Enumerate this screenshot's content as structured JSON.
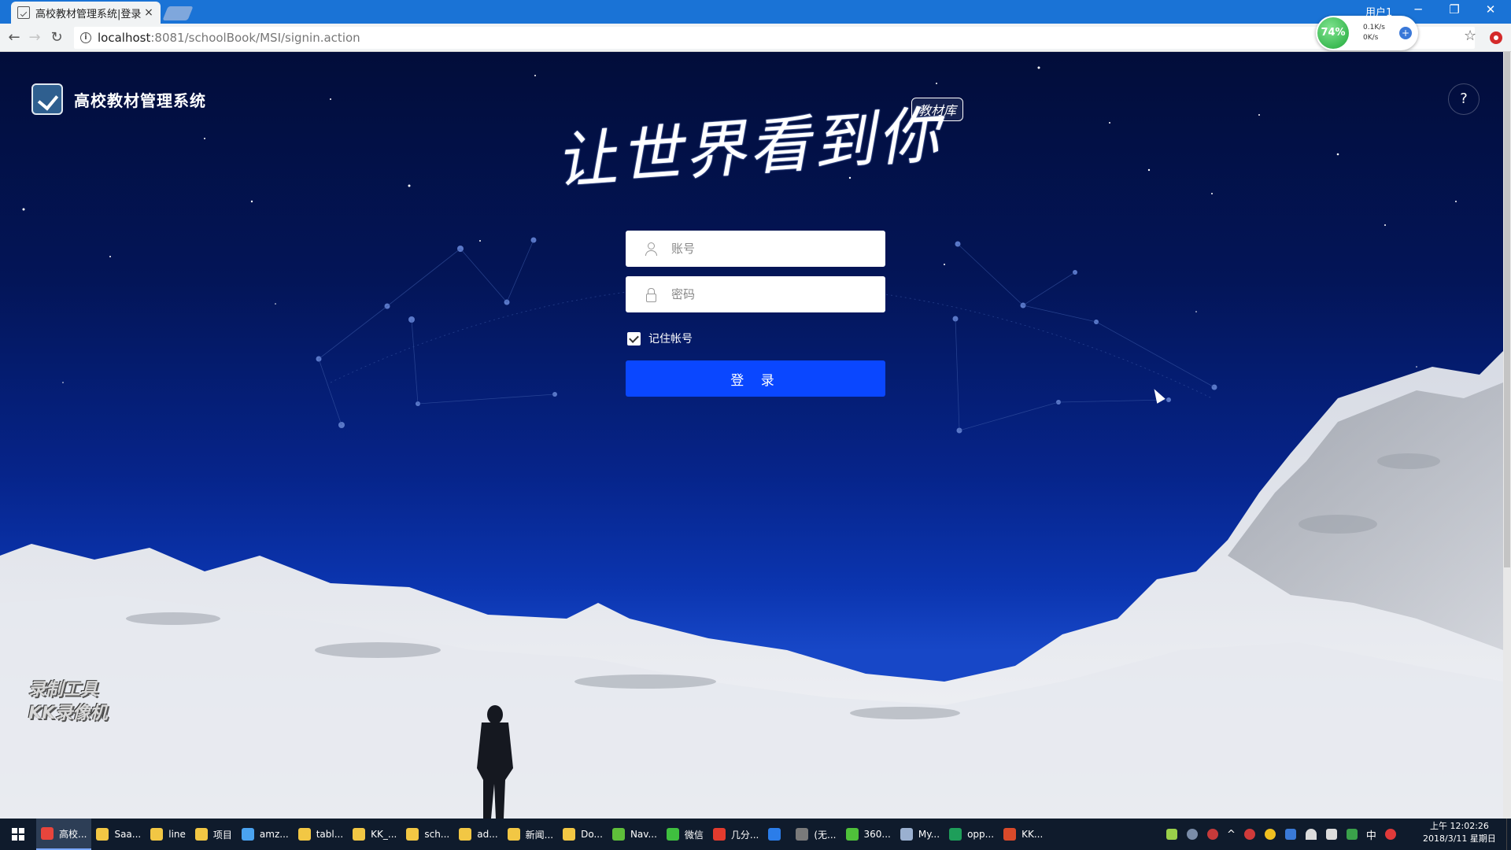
{
  "browser": {
    "tab_title": "高校教材管理系统|登录",
    "tab_close": "×",
    "window_user": "用户1",
    "window_controls": {
      "minimize": "─",
      "restore": "❐",
      "close": "✕"
    },
    "nav": {
      "back": "←",
      "forward": "→",
      "reload": "↻"
    },
    "url_host": "localhost",
    "url_rest": ":8081/schoolBook/MSI/signin.action",
    "info_glyph": "i",
    "star_glyph": "☆",
    "perf": {
      "percent": "74%",
      "upload": "0.1K/s",
      "download": "0K/s",
      "plus": "+"
    }
  },
  "page": {
    "app_title": "高校教材管理系统",
    "help": "?",
    "slogan": "让世界看到你",
    "badge": "教材库",
    "username_placeholder": "账号",
    "password_placeholder": "密码",
    "remember_label": "记住帐号",
    "remember_checked": true,
    "login_label": "登 录",
    "watermark_line1": "录制工具",
    "watermark_line2": "KK录像机"
  },
  "taskbar": {
    "items": [
      {
        "label": "高校...",
        "icon": "chrome-icon",
        "color": "#e8453c",
        "active": true
      },
      {
        "label": "Saa...",
        "icon": "folder-icon",
        "color": "#f2c744"
      },
      {
        "label": "line",
        "icon": "folder-icon",
        "color": "#f2c744"
      },
      {
        "label": "项目",
        "icon": "folder-icon",
        "color": "#f2c744"
      },
      {
        "label": "amz...",
        "icon": "cube-icon",
        "color": "#4aa3f0"
      },
      {
        "label": "tabl...",
        "icon": "folder-icon",
        "color": "#f2c744"
      },
      {
        "label": "KK_...",
        "icon": "folder-icon",
        "color": "#f2c744"
      },
      {
        "label": "sch...",
        "icon": "folder-icon",
        "color": "#f2c744"
      },
      {
        "label": "ad...",
        "icon": "folder-icon",
        "color": "#f2c744"
      },
      {
        "label": "新闻...",
        "icon": "folder-icon",
        "color": "#f2c744"
      },
      {
        "label": "Do...",
        "icon": "folder-icon",
        "color": "#f2c744"
      },
      {
        "label": "Nav...",
        "icon": "navicat-icon",
        "color": "#5fbf3a"
      },
      {
        "label": "微信",
        "icon": "wechat-icon",
        "color": "#3fbf3f"
      },
      {
        "label": "几分...",
        "icon": "weibo-icon",
        "color": "#e33b2e"
      },
      {
        "label": "",
        "icon": "word-icon",
        "color": "#2b7de9"
      },
      {
        "label": "(无...",
        "icon": "app-icon",
        "color": "#7a7a7a"
      },
      {
        "label": "360...",
        "icon": "360-icon",
        "color": "#4fc13a"
      },
      {
        "label": "My...",
        "icon": "pen-icon",
        "color": "#9ab0d0"
      },
      {
        "label": "opp...",
        "icon": "oppo-icon",
        "color": "#1e9e5a"
      },
      {
        "label": "KK...",
        "icon": "kk-icon",
        "color": "#d94a2a"
      }
    ],
    "tray": {
      "ime": "中",
      "time": "上午 12:02:26",
      "date": "2018/3/11 星期日"
    }
  }
}
